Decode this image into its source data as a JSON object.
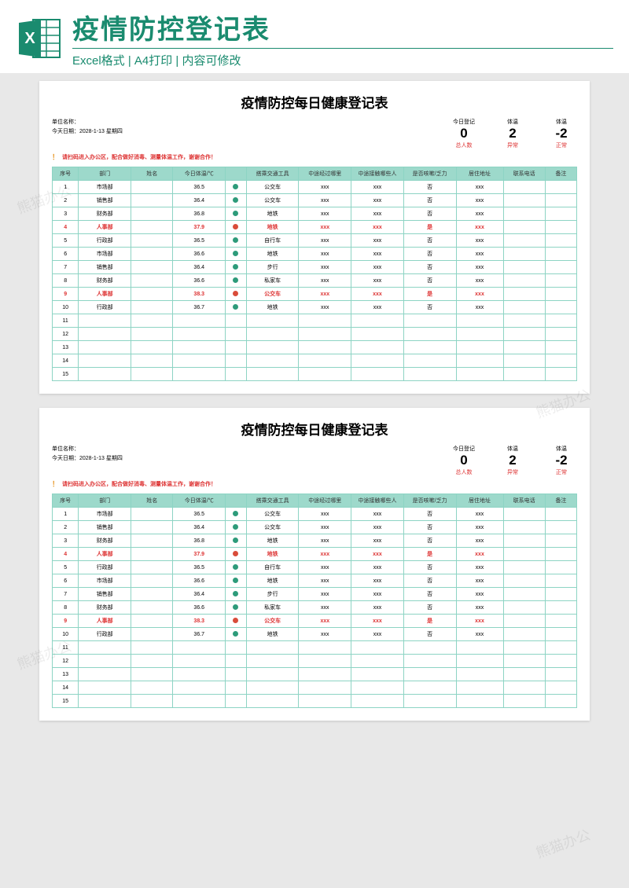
{
  "header": {
    "title": "疫情防控登记表",
    "subtitle": "Excel格式 | A4打印 | 内容可修改"
  },
  "sheet": {
    "title": "疫情防控每日健康登记表",
    "unit_label": "单位名称：",
    "date_label": "今天日期：",
    "date_value": "2028-1-13  星期四",
    "warning": "请扫码进入办公区，配合做好消毒、测量体温工作，谢谢合作！",
    "stats": [
      {
        "label": "今日登记",
        "value": "0",
        "sub": "总人数"
      },
      {
        "label": "体温",
        "value": "2",
        "sub": "异常"
      },
      {
        "label": "体温",
        "value": "-2",
        "sub": "正常"
      }
    ],
    "headers": [
      "序号",
      "部门",
      "姓名",
      "今日体温/℃",
      "",
      "搭乘交通工具",
      "中途经过哪里",
      "中途接触哪些人",
      "是否咳嗽/乏力",
      "居住地址",
      "联系电话",
      "备注"
    ],
    "rows": [
      {
        "seq": "1",
        "dept": "市场部",
        "name": "",
        "temp": "36.5",
        "ok": true,
        "trans": "公交车",
        "route": "xxx",
        "contact": "xxx",
        "symp": "否",
        "addr": "xxx",
        "phone": "",
        "note": "",
        "red": false
      },
      {
        "seq": "2",
        "dept": "销售部",
        "name": "",
        "temp": "36.4",
        "ok": true,
        "trans": "公交车",
        "route": "xxx",
        "contact": "xxx",
        "symp": "否",
        "addr": "xxx",
        "phone": "",
        "note": "",
        "red": false
      },
      {
        "seq": "3",
        "dept": "财务部",
        "name": "",
        "temp": "36.8",
        "ok": true,
        "trans": "地铁",
        "route": "xxx",
        "contact": "xxx",
        "symp": "否",
        "addr": "xxx",
        "phone": "",
        "note": "",
        "red": false
      },
      {
        "seq": "4",
        "dept": "人事部",
        "name": "",
        "temp": "37.9",
        "ok": false,
        "trans": "地铁",
        "route": "xxx",
        "contact": "xxx",
        "symp": "是",
        "addr": "xxx",
        "phone": "",
        "note": "",
        "red": true
      },
      {
        "seq": "5",
        "dept": "行政部",
        "name": "",
        "temp": "36.5",
        "ok": true,
        "trans": "自行车",
        "route": "xxx",
        "contact": "xxx",
        "symp": "否",
        "addr": "xxx",
        "phone": "",
        "note": "",
        "red": false
      },
      {
        "seq": "6",
        "dept": "市场部",
        "name": "",
        "temp": "36.6",
        "ok": true,
        "trans": "地铁",
        "route": "xxx",
        "contact": "xxx",
        "symp": "否",
        "addr": "xxx",
        "phone": "",
        "note": "",
        "red": false
      },
      {
        "seq": "7",
        "dept": "销售部",
        "name": "",
        "temp": "36.4",
        "ok": true,
        "trans": "步行",
        "route": "xxx",
        "contact": "xxx",
        "symp": "否",
        "addr": "xxx",
        "phone": "",
        "note": "",
        "red": false
      },
      {
        "seq": "8",
        "dept": "财务部",
        "name": "",
        "temp": "36.6",
        "ok": true,
        "trans": "私家车",
        "route": "xxx",
        "contact": "xxx",
        "symp": "否",
        "addr": "xxx",
        "phone": "",
        "note": "",
        "red": false
      },
      {
        "seq": "9",
        "dept": "人事部",
        "name": "",
        "temp": "38.3",
        "ok": false,
        "trans": "公交车",
        "route": "xxx",
        "contact": "xxx",
        "symp": "是",
        "addr": "xxx",
        "phone": "",
        "note": "",
        "red": true
      },
      {
        "seq": "10",
        "dept": "行政部",
        "name": "",
        "temp": "36.7",
        "ok": true,
        "trans": "地铁",
        "route": "xxx",
        "contact": "xxx",
        "symp": "否",
        "addr": "xxx",
        "phone": "",
        "note": "",
        "red": false
      },
      {
        "seq": "11",
        "dept": "",
        "name": "",
        "temp": "",
        "ok": null,
        "trans": "",
        "route": "",
        "contact": "",
        "symp": "",
        "addr": "",
        "phone": "",
        "note": "",
        "red": false
      },
      {
        "seq": "12",
        "dept": "",
        "name": "",
        "temp": "",
        "ok": null,
        "trans": "",
        "route": "",
        "contact": "",
        "symp": "",
        "addr": "",
        "phone": "",
        "note": "",
        "red": false
      },
      {
        "seq": "13",
        "dept": "",
        "name": "",
        "temp": "",
        "ok": null,
        "trans": "",
        "route": "",
        "contact": "",
        "symp": "",
        "addr": "",
        "phone": "",
        "note": "",
        "red": false
      },
      {
        "seq": "14",
        "dept": "",
        "name": "",
        "temp": "",
        "ok": null,
        "trans": "",
        "route": "",
        "contact": "",
        "symp": "",
        "addr": "",
        "phone": "",
        "note": "",
        "red": false
      },
      {
        "seq": "15",
        "dept": "",
        "name": "",
        "temp": "",
        "ok": null,
        "trans": "",
        "route": "",
        "contact": "",
        "symp": "",
        "addr": "",
        "phone": "",
        "note": "",
        "red": false
      }
    ]
  },
  "watermark": "熊猫办公"
}
